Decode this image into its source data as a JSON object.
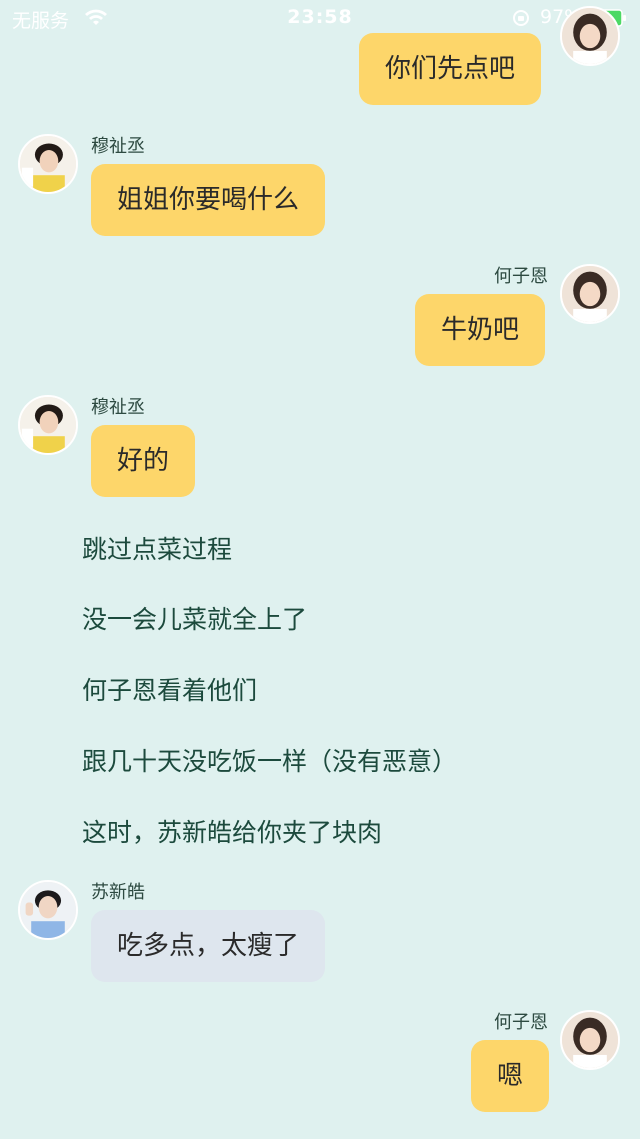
{
  "status_bar": {
    "carrier": "无服务",
    "time": "23:58",
    "battery_percent": "97%"
  },
  "messages": [
    {
      "side": "right",
      "sender": "",
      "text": "你们先点吧"
    },
    {
      "side": "left",
      "sender": "穆祉丞",
      "text": "姐姐你要喝什么"
    },
    {
      "side": "right",
      "sender": "何子恩",
      "text": "牛奶吧"
    },
    {
      "side": "left",
      "sender": "穆祉丞",
      "text": "好的"
    }
  ],
  "narration": [
    "跳过点菜过程",
    "没一会儿菜就全上了",
    "何子恩看着他们",
    "跟几十天没吃饭一样（没有恶意）",
    "这时，苏新皓给你夹了块肉"
  ],
  "messages_2": [
    {
      "side": "left",
      "sender": "苏新皓",
      "text": "吃多点，太瘦了"
    },
    {
      "side": "right",
      "sender": "何子恩",
      "text": "嗯"
    }
  ],
  "colors": {
    "background": "#dff1ef",
    "bubble_yellow": "#fdd66a",
    "bubble_gray": "#dee6ee",
    "narration_text": "#1c4a3d"
  }
}
